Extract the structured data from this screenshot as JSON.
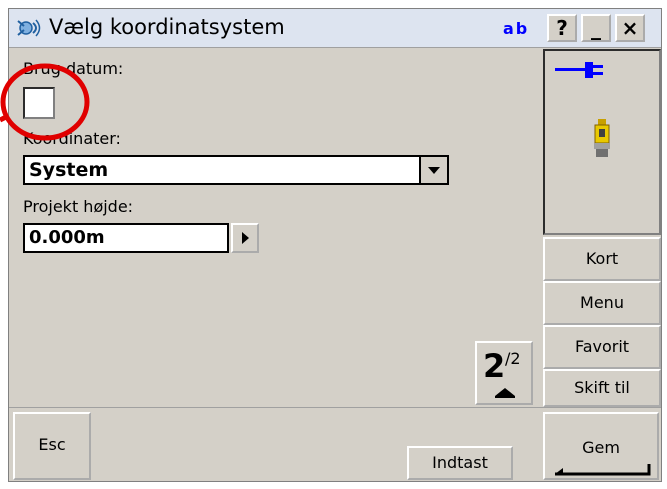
{
  "window": {
    "title": "Vælg koordinatsystem",
    "input_mode": "ab",
    "help_label": "?",
    "minimize_label": "_",
    "close_label": "×"
  },
  "form": {
    "use_datum_label": "Brug datum:",
    "use_datum_checked": false,
    "coordinates_label": "Koordinater:",
    "coordinates_value": "System",
    "project_height_label": "Projekt højde:",
    "project_height_value": "0.000m"
  },
  "pager": {
    "current": "2",
    "total": "/2"
  },
  "side_buttons": [
    {
      "label": "Kort"
    },
    {
      "label": "Menu"
    },
    {
      "label": "Favorit"
    },
    {
      "label": "Skift til"
    }
  ],
  "bottom": {
    "esc_label": "Esc",
    "indtast_label": "Indtast",
    "gem_label": "Gem"
  },
  "icons": {
    "app": "satellite-icon",
    "power": "power-plug-icon",
    "instrument": "total-station-icon"
  },
  "colors": {
    "accent": "#0000ff",
    "annotation": "#e00000",
    "titlebar": "#dde4f0",
    "panel": "#d4d0c8"
  }
}
